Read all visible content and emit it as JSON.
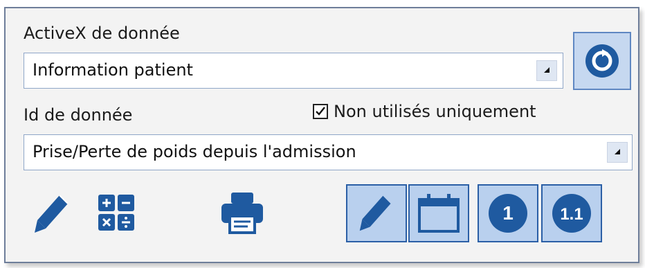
{
  "activex": {
    "label": "ActiveX de donnée",
    "value": "Information patient"
  },
  "donnee": {
    "label": "Id de donnée",
    "value": "Prise/Perte de poids depuis l'admission"
  },
  "filter": {
    "label": "Non utilisés uniquement",
    "checked": true
  },
  "toolbar": {
    "value_one": "1",
    "value_decimal": "1.1"
  },
  "colors": {
    "icon_blue": "#1f5aa0",
    "button_fill": "#b9d0ee",
    "button_border": "#2b5fa6"
  }
}
